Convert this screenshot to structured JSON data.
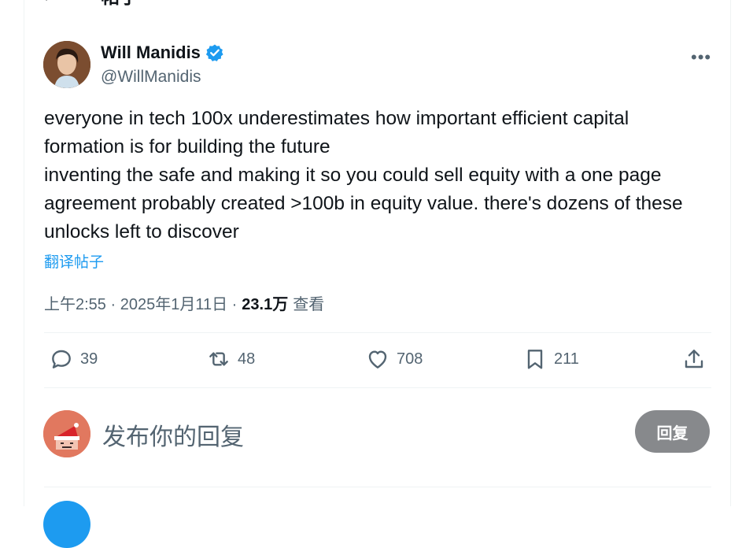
{
  "header": {
    "title": "帖子"
  },
  "tweet": {
    "author_name": "Will Manidis",
    "author_handle": "@WillManidis",
    "text": "everyone in tech 100x underestimates how important efficient capital formation is for building the future\ninventing the safe and making it so you could sell equity with a one page agreement probably created >100b in equity value. there's dozens of these unlocks left to discover",
    "translate_label": "翻译帖子",
    "time": "上午2:55 · 2025年1月11日 ·",
    "views_count": "23.1万",
    "views_label": "查看"
  },
  "actions": {
    "replies": "39",
    "reposts": "48",
    "likes": "708",
    "bookmarks": "211"
  },
  "reply_box": {
    "placeholder": "发布你的回复",
    "button_label": "回复"
  },
  "colors": {
    "accent": "#1d9bf0",
    "secondary_text": "#536471",
    "primary_text": "#0f1419",
    "disabled_button": "#87898c"
  },
  "icons": [
    "back-arrow-icon",
    "verified-badge-icon",
    "more-icon",
    "reply-icon",
    "repost-icon",
    "like-icon",
    "bookmark-icon",
    "share-icon"
  ]
}
